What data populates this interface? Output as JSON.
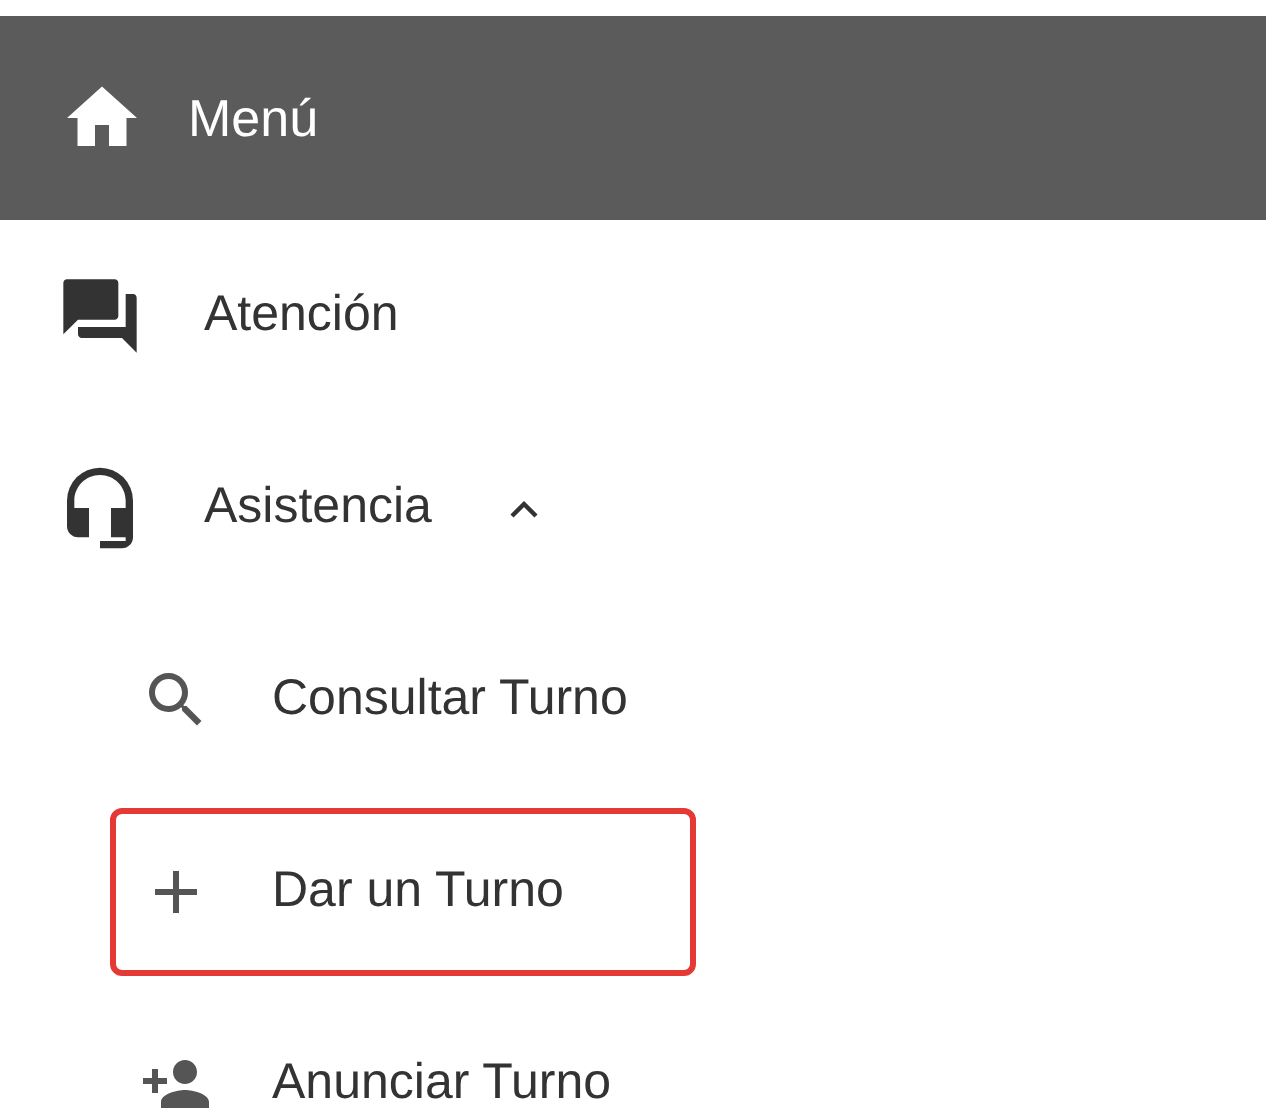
{
  "header": {
    "title": "Menú"
  },
  "items": [
    {
      "label": "Atención"
    },
    {
      "label": "Asistencia",
      "expanded": true,
      "children": [
        {
          "label": "Consultar Turno",
          "highlighted": false
        },
        {
          "label": "Dar un Turno",
          "highlighted": true
        },
        {
          "label": "Anunciar Turno",
          "highlighted": false
        }
      ]
    }
  ]
}
